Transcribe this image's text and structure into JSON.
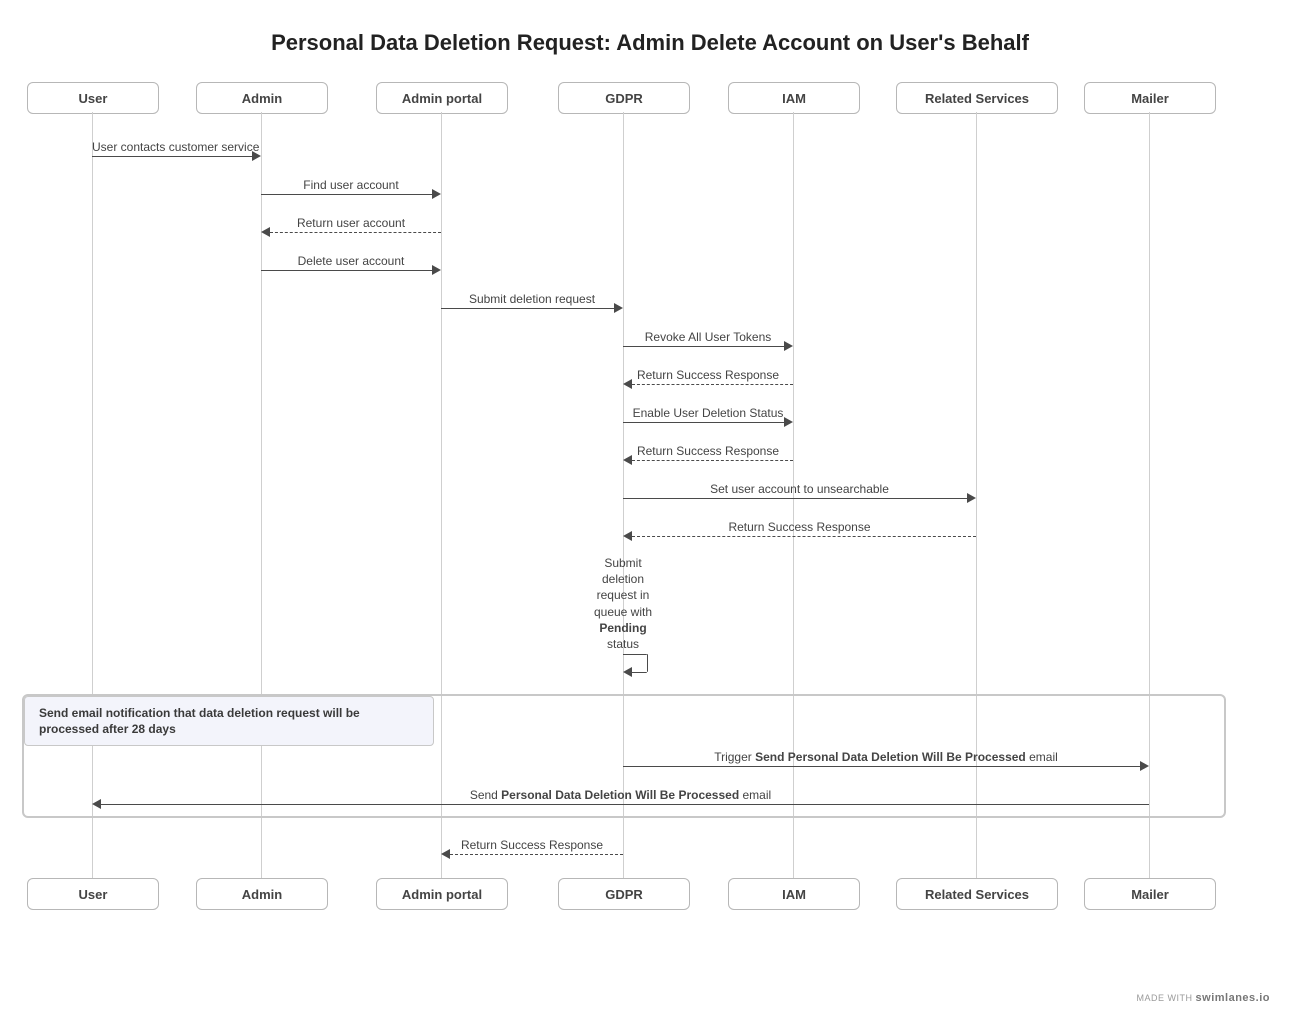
{
  "title": "Personal Data Deletion Request: Admin Delete Account on User's Behalf",
  "lanes": {
    "user": "User",
    "admin": "Admin",
    "portal": "Admin portal",
    "gdpr": "GDPR",
    "iam": "IAM",
    "services": "Related Services",
    "mailer": "Mailer"
  },
  "messages": {
    "m1": "User contacts customer service",
    "m2": "Find user account",
    "m3": "Return user account",
    "m4": "Delete user account",
    "m5": "Submit deletion request",
    "m6": "Revoke All User Tokens",
    "m7": "Return Success Response",
    "m8": "Enable User Deletion Status",
    "m9": "Return Success Response",
    "m10": "Set user account to unsearchable",
    "m11": "Return Success Response",
    "m12_l1": "Submit",
    "m12_l2": "deletion",
    "m12_l3": "request in",
    "m12_l4": "queue with",
    "m12_l5_bold": "Pending",
    "m12_l6": "status",
    "m14_pre": "Trigger ",
    "m14_bold": "Send Personal Data Deletion Will Be Processed",
    "m14_post": " email",
    "m15_pre": "Send ",
    "m15_bold": "Personal Data Deletion Will Be Processed",
    "m15_post": " email",
    "m16": "Return Success Response"
  },
  "group": {
    "line1": "Send email notification that data deletion request will be",
    "line2": "processed after 28 days"
  },
  "footer": {
    "pre": "MADE WITH ",
    "brand": "swimlanes.io"
  },
  "chart_data": {
    "type": "sequence-diagram",
    "title": "Personal Data Deletion Request: Admin Delete Account on User's Behalf",
    "participants": [
      "User",
      "Admin",
      "Admin portal",
      "GDPR",
      "IAM",
      "Related Services",
      "Mailer"
    ],
    "messages": [
      {
        "from": "User",
        "to": "Admin",
        "label": "User contacts customer service",
        "style": "solid"
      },
      {
        "from": "Admin",
        "to": "Admin portal",
        "label": "Find user account",
        "style": "solid"
      },
      {
        "from": "Admin portal",
        "to": "Admin",
        "label": "Return user account",
        "style": "dashed"
      },
      {
        "from": "Admin",
        "to": "Admin portal",
        "label": "Delete user account",
        "style": "solid"
      },
      {
        "from": "Admin portal",
        "to": "GDPR",
        "label": "Submit deletion request",
        "style": "solid"
      },
      {
        "from": "GDPR",
        "to": "IAM",
        "label": "Revoke All User Tokens",
        "style": "solid"
      },
      {
        "from": "IAM",
        "to": "GDPR",
        "label": "Return Success Response",
        "style": "dashed"
      },
      {
        "from": "GDPR",
        "to": "IAM",
        "label": "Enable User Deletion Status",
        "style": "solid"
      },
      {
        "from": "IAM",
        "to": "GDPR",
        "label": "Return Success Response",
        "style": "dashed"
      },
      {
        "from": "GDPR",
        "to": "Related Services",
        "label": "Set user account to unsearchable",
        "style": "solid"
      },
      {
        "from": "Related Services",
        "to": "GDPR",
        "label": "Return Success Response",
        "style": "dashed"
      },
      {
        "from": "GDPR",
        "to": "GDPR",
        "label": "Submit deletion request in queue with Pending status",
        "style": "solid",
        "self": true
      },
      {
        "group": "Send email notification that data deletion request will be processed after 28 days",
        "messages": [
          {
            "from": "GDPR",
            "to": "Mailer",
            "label": "Trigger Send Personal Data Deletion Will Be Processed email",
            "style": "solid"
          },
          {
            "from": "Mailer",
            "to": "User",
            "label": "Send Personal Data Deletion Will Be Processed email",
            "style": "solid"
          }
        ]
      },
      {
        "from": "GDPR",
        "to": "Admin portal",
        "label": "Return Success Response",
        "style": "dashed"
      }
    ]
  }
}
